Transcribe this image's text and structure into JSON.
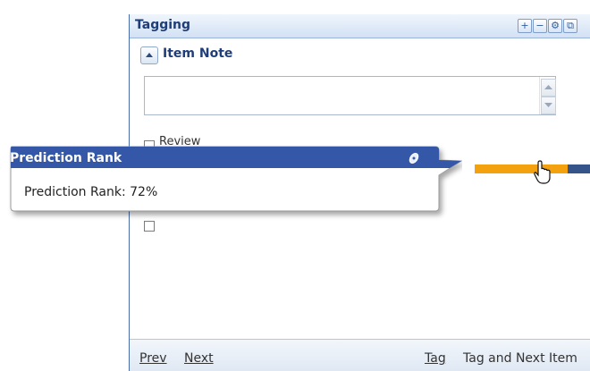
{
  "panel": {
    "title": "Tagging",
    "tool_icons": [
      "plus-icon",
      "minus-icon",
      "settings-icon",
      "popout-icon"
    ]
  },
  "item_note": {
    "title": "Item Note",
    "value": ""
  },
  "review": {
    "label": "Review",
    "checked": false
  },
  "prediction_rank": {
    "value_fraction": 0.72,
    "fill_color": "#f3a10f",
    "track_color": "#35558a"
  },
  "tooltip": {
    "title": "Prediction Rank",
    "body": "Prediction Rank: 72%",
    "header_color": "#3557a7",
    "pin_icon": "pin-icon"
  },
  "footer": {
    "prev_label": "Prev",
    "next_label": "Next",
    "tag_label": "Tag",
    "tag_next_label": "Tag and Next Item"
  },
  "colors": {
    "panel_title": "#1f3d78",
    "header_bg": "#d2e1f4"
  }
}
